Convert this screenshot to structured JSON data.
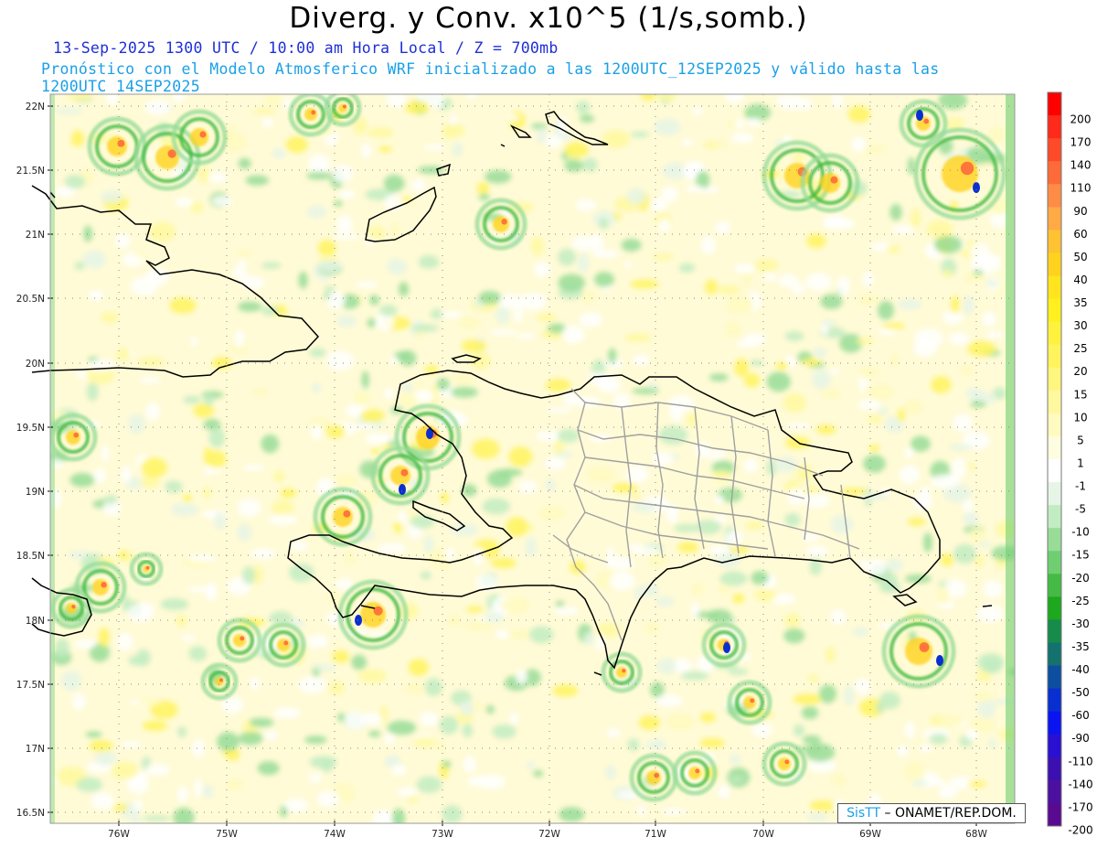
{
  "title": "Diverg. y Conv. x10^5 (1/s,somb.)",
  "subtitle_valid": "13-Sep-2025  1300 UTC / 10:00 am Hora Local / Z = 700mb",
  "subtitle_model": "Pronóstico con el Modelo Atmosferico WRF inicializado a las 1200UTC_12SEP2025 y válido hasta las  1200UTC_14SEP2025",
  "lat_labels": [
    "22N",
    "21.5N",
    "21N",
    "20.5N",
    "20N",
    "19.5N",
    "19N",
    "18.5N",
    "18N",
    "17.5N",
    "17N",
    "16.5N"
  ],
  "lon_labels": [
    "76W",
    "75W",
    "74W",
    "73W",
    "72W",
    "71W",
    "70W",
    "69W",
    "68W"
  ],
  "colorbar": {
    "labels": [
      "200",
      "170",
      "140",
      "110",
      "90",
      "60",
      "50",
      "40",
      "35",
      "30",
      "25",
      "20",
      "15",
      "10",
      "5",
      "1",
      "-1",
      "-5",
      "-10",
      "-15",
      "-20",
      "-25",
      "-30",
      "-35",
      "-40",
      "-50",
      "-60",
      "-90",
      "-110",
      "-140",
      "-170",
      "-200"
    ],
    "colors": [
      "#ff0000",
      "#ff2a1a",
      "#ff4a2a",
      "#ff6a3a",
      "#ff8c46",
      "#ffaa44",
      "#ffc233",
      "#ffd21e",
      "#ffe41e",
      "#fff01e",
      "#fff23f",
      "#fff35e",
      "#fff67e",
      "#fff89e",
      "#fffabe",
      "#fffde0",
      "#ffffff",
      "#e6f5e6",
      "#c2ecc2",
      "#98dc98",
      "#6fce6f",
      "#44bb44",
      "#1ea81e",
      "#168b4a",
      "#13726e",
      "#0c4ea0",
      "#0a2fd0",
      "#0a14f0",
      "#2a10d0",
      "#3c10b0",
      "#4c10a0",
      "#5a0a90"
    ]
  },
  "credit": {
    "brand": "SisTT",
    "org": "– ONAMET/REP.DOM."
  }
}
